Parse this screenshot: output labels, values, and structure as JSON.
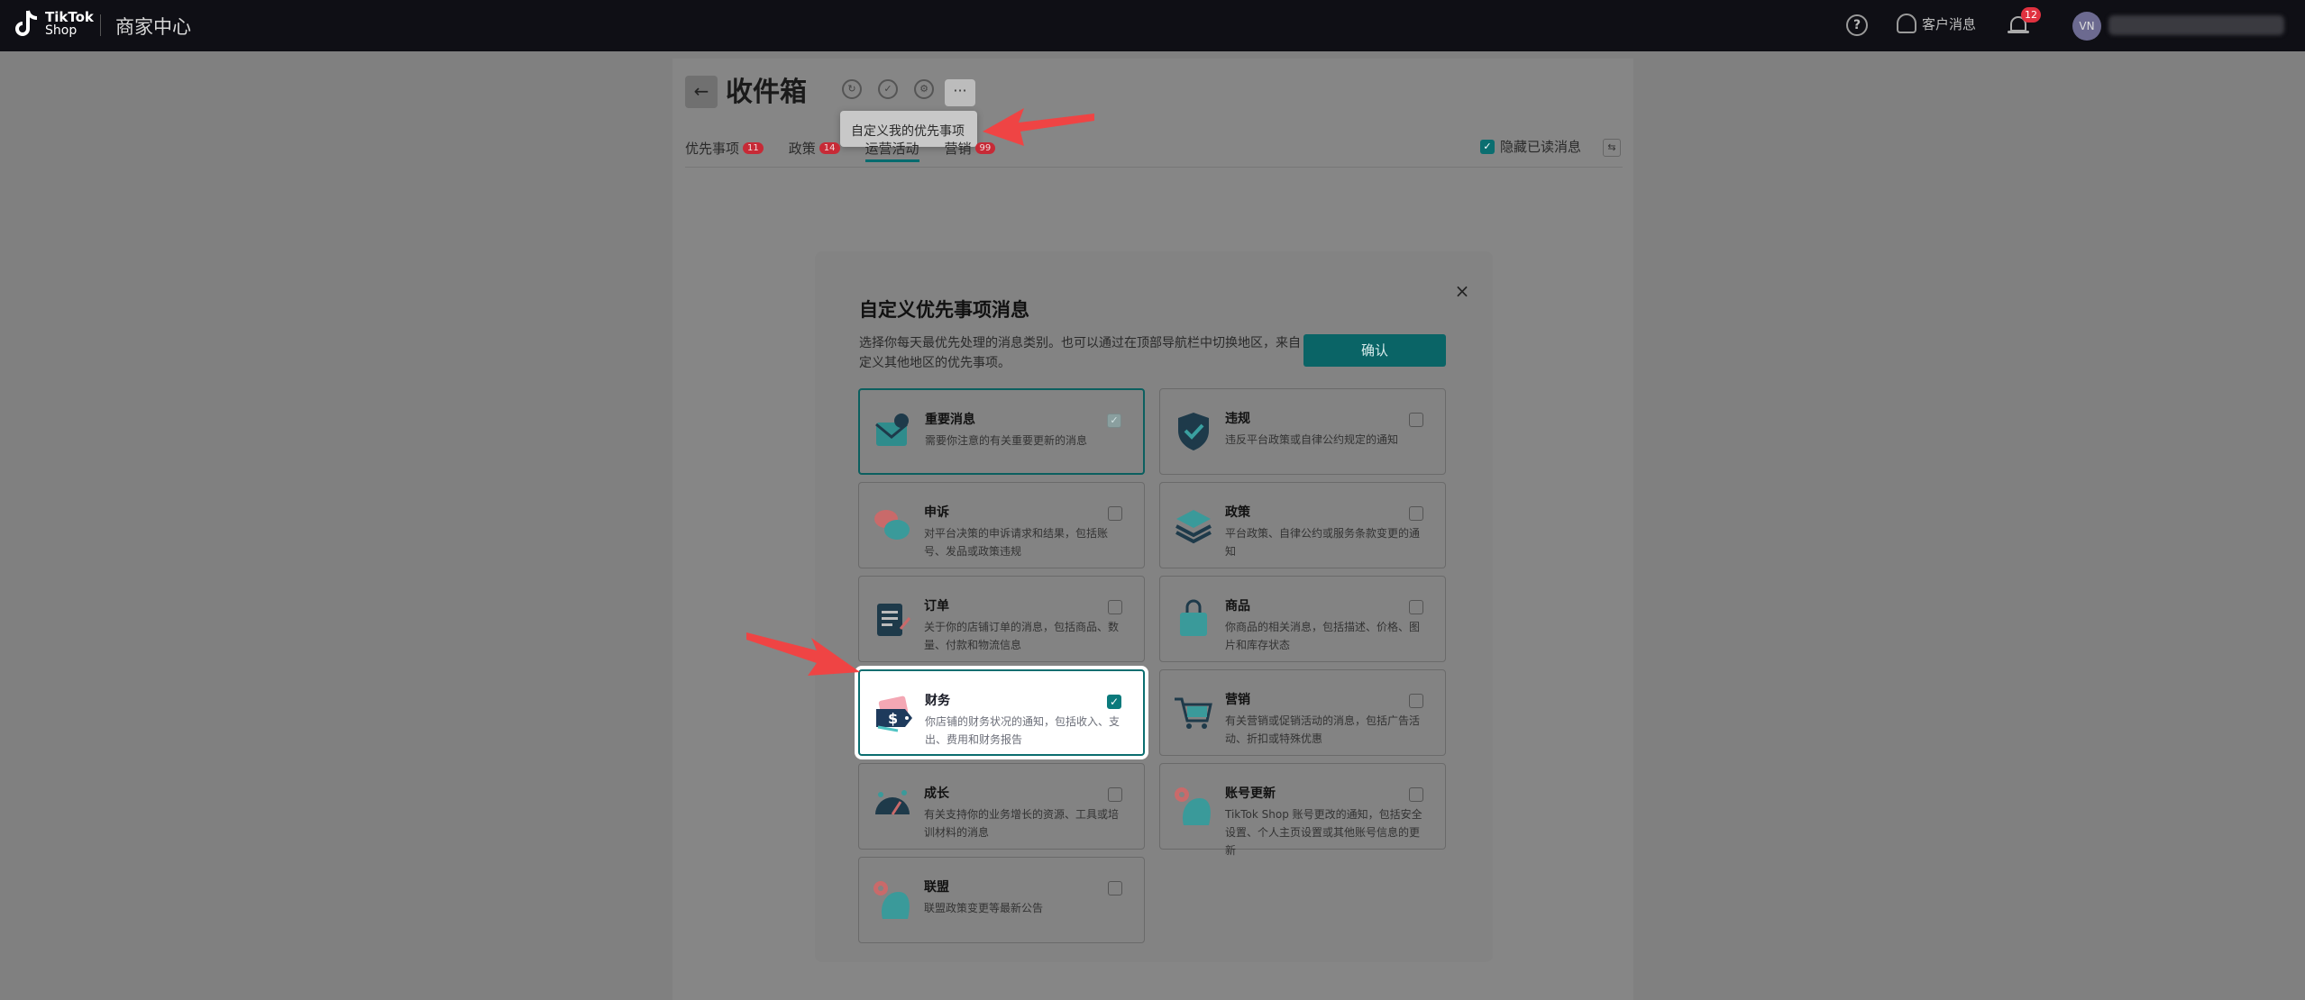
{
  "topbar": {
    "logo_line1": "TikTok",
    "logo_line2": "Shop",
    "center_title": "商家中心",
    "help_glyph": "?",
    "customer_msg": "客户消息",
    "bell_count": "12",
    "avatar_initials": "VN"
  },
  "page": {
    "title": "收件箱",
    "back_glyph": "←",
    "more_glyph": "···",
    "dropdown_item": "自定义我的优先事项",
    "tabs": [
      {
        "label": "优先事项",
        "badge": "11"
      },
      {
        "label": "政策",
        "badge": "14"
      },
      {
        "label": "运营活动",
        "badge": ""
      },
      {
        "label": "营销",
        "badge": "99"
      }
    ],
    "hide_read": "隐藏已读消息"
  },
  "modal": {
    "title": "自定义优先事项消息",
    "description": "选择你每天最优先处理的消息类别。也可以通过在顶部导航栏中切换地区，来自定义其他地区的优先事项。",
    "confirm": "确认",
    "close_glyph": "×",
    "categories": [
      {
        "name": "重要消息",
        "desc": "需要你注意的有关重要更新的消息",
        "checked": true
      },
      {
        "name": "违规",
        "desc": "违反平台政策或自律公约规定的通知",
        "checked": false
      },
      {
        "name": "申诉",
        "desc": "对平台决策的申诉请求和结果，包括账号、发品或政策违规",
        "checked": false
      },
      {
        "name": "政策",
        "desc": "平台政策、自律公约或服务条款变更的通知",
        "checked": false
      },
      {
        "name": "订单",
        "desc": "关于你的店铺订单的消息，包括商品、数量、付款和物流信息",
        "checked": false
      },
      {
        "name": "商品",
        "desc": "你商品的相关消息，包括描述、价格、图片和库存状态",
        "checked": false
      },
      {
        "name": "财务",
        "desc": "你店铺的财务状况的通知，包括收入、支出、费用和财务报告",
        "checked": true
      },
      {
        "name": "营销",
        "desc": "有关营销或促销活动的消息，包括广告活动、折扣或特殊优惠",
        "checked": false
      },
      {
        "name": "成长",
        "desc": "有关支持你的业务增长的资源、工具或培训材料的消息",
        "checked": false
      },
      {
        "name": "账号更新",
        "desc": "TikTok Shop 账号更改的通知，包括安全设置、个人主页设置或其他账号信息的更新",
        "checked": false
      },
      {
        "name": "联盟",
        "desc": "联盟政策变更等最新公告",
        "checked": false
      }
    ]
  },
  "colors": {
    "accent": "#0b7a7c",
    "arrow": "#ef4444",
    "badge": "#e0313f"
  }
}
